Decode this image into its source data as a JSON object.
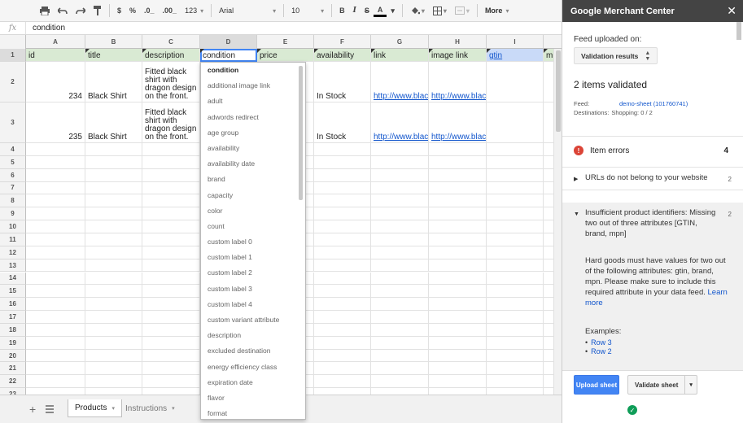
{
  "toolbar": {
    "currency": "$",
    "percent": "%",
    "dec_decrease": ".0_",
    "dec_increase": ".00_",
    "number_format": "123",
    "font": "Arial",
    "font_size": "10",
    "bold": "B",
    "italic": "I",
    "strike": "S",
    "text_color": "A",
    "more": "More"
  },
  "formula": {
    "fx": "fx",
    "value": "condition"
  },
  "columns": [
    "A",
    "B",
    "C",
    "D",
    "E",
    "F",
    "G",
    "H",
    "I"
  ],
  "rows": [
    "1",
    "2",
    "3",
    "4",
    "5",
    "6",
    "7",
    "8",
    "9",
    "10",
    "11",
    "12",
    "13",
    "14",
    "15",
    "16",
    "17",
    "18",
    "19",
    "20",
    "21",
    "22",
    "23"
  ],
  "sheet": {
    "headers": [
      "id",
      "title",
      "description",
      "condition",
      "price",
      "availability",
      "link",
      "image link",
      "gtin",
      "mp"
    ],
    "data": [
      {
        "id": "234",
        "title": "Black Shirt",
        "description": "Fitted black shirt with dragon design on the front.",
        "availability": "In Stock",
        "link": "http://www.blacl",
        "image_link": "http://www.blacl"
      },
      {
        "id": "235",
        "title": "Black Shirt",
        "description": "Fitted black shirt with dragon design on the front.",
        "availability": "In Stock",
        "link": "http://www.blacl",
        "image_link": "http://www.blacl"
      }
    ]
  },
  "dropdown": {
    "items": [
      "condition",
      "additional image link",
      "adult",
      "adwords redirect",
      "age group",
      "availability",
      "availability date",
      "brand",
      "capacity",
      "color",
      "count",
      "custom label 0",
      "custom label 1",
      "custom label 2",
      "custom label 3",
      "custom label 4",
      "custom variant attribute",
      "description",
      "excluded destination",
      "energy efficiency class",
      "expiration date",
      "flavor",
      "format"
    ]
  },
  "tabs": {
    "add": "+",
    "active": "Products",
    "inactive": "Instructions"
  },
  "panel": {
    "title": "Google Merchant Center",
    "close": "✕",
    "feed_label": "Feed uploaded on:",
    "select_value": "Validation results",
    "items_validated": "2 items validated",
    "feed_key": "Feed:",
    "feed_value": "demo-sheet (101760741)",
    "dest_key": "Destinations:",
    "dest_value": "Shopping: 0 / 2",
    "errors_label": "Item errors",
    "errors_count": "4",
    "issue1_text": "URLs do not belong to your website",
    "issue1_count": "2",
    "issue2_text": "Insufficient product identifiers: Missing two out of three attributes [GTIN, brand, mpn]",
    "issue2_count": "2",
    "issue2_desc": "Hard goods must have values for two out of the following attributes: gtin, brand, mpn. Please make sure to include this required attribute in your data feed.",
    "learn_more": "Learn more",
    "examples_label": "Examples:",
    "examples": [
      "Row 3",
      "Row 2"
    ],
    "upload_button": "Upload sheet",
    "validate_button": "Validate sheet"
  }
}
